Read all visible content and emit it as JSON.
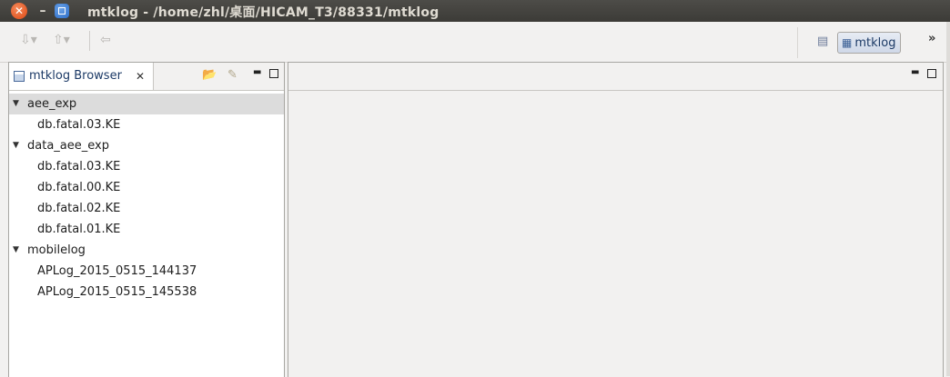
{
  "window": {
    "title": "mtklog - /home/zhl/桌面/HICAM_T3/88331/mtklog",
    "close_glyph": "✕",
    "min_glyph": "–"
  },
  "toolbar": {
    "tools": [
      "next-annotation-icon",
      "previous-annotation-icon",
      "back-icon"
    ],
    "perspective_label": "mtklog",
    "more_glyph": "»"
  },
  "browser": {
    "tab_label": "mtklog Browser",
    "close_glyph": "✕",
    "tree": [
      {
        "label": "aee_exp",
        "expanded": true,
        "selected": true,
        "children": [
          "db.fatal.03.KE"
        ]
      },
      {
        "label": "data_aee_exp",
        "expanded": true,
        "selected": false,
        "children": [
          "db.fatal.03.KE",
          "db.fatal.00.KE",
          "db.fatal.02.KE",
          "db.fatal.01.KE"
        ]
      },
      {
        "label": "mobilelog",
        "expanded": true,
        "selected": false,
        "children": [
          "APLog_2015_0515_144137",
          "APLog_2015_0515_145538"
        ]
      }
    ]
  },
  "colors": {
    "titlebar": "#3c3b37",
    "close": "#dd4814",
    "maximize": "#2d6ec8",
    "selection": "#dcdcdc"
  }
}
